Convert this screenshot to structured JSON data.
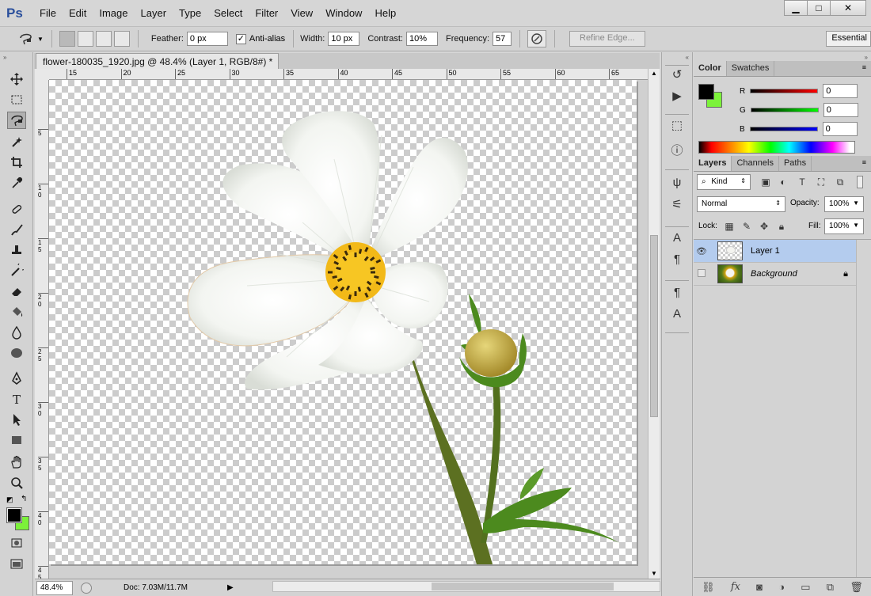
{
  "app": {
    "logo": "Ps",
    "brand_color": "#2a4f9c"
  },
  "menubar": {
    "items": [
      "File",
      "Edit",
      "Image",
      "Layer",
      "Type",
      "Select",
      "Filter",
      "View",
      "Window",
      "Help"
    ]
  },
  "window_controls": {
    "minimize": "▁",
    "maximize": "□",
    "close": "✕"
  },
  "options": {
    "feather_label": "Feather:",
    "feather_value": "0 px",
    "antialias_label": "Anti-alias",
    "antialias_checked": true,
    "width_label": "Width:",
    "width_value": "10 px",
    "contrast_label": "Contrast:",
    "contrast_value": "10%",
    "frequency_label": "Frequency:",
    "frequency_value": "57",
    "refine_label": "Refine Edge...",
    "workspace": "Essential"
  },
  "document": {
    "tab_title": "flower-180035_1920.jpg @ 48.4% (Layer 1, RGB/8#) *",
    "close": "×"
  },
  "ruler": {
    "top_ticks": [
      "15",
      "20",
      "25",
      "30",
      "35",
      "40",
      "45",
      "50",
      "55",
      "60",
      "65"
    ],
    "left_ticks": [
      "5",
      "1",
      "1",
      "2",
      "2",
      "3",
      "3",
      "4",
      "4"
    ],
    "left_ticks2": [
      "",
      "0",
      "5",
      "0",
      "5",
      "0",
      "5",
      "0",
      "5"
    ]
  },
  "status": {
    "zoom": "48.4%",
    "doc": "Doc: 7.03M/11.7M"
  },
  "color_panel": {
    "tabs": [
      "Color",
      "Swatches"
    ],
    "r_label": "R",
    "g_label": "G",
    "b_label": "B",
    "r": "0",
    "g": "0",
    "b": "0",
    "foreground": "#000000",
    "background": "#7cf23a"
  },
  "layers_panel": {
    "tabs": [
      "Layers",
      "Channels",
      "Paths"
    ],
    "kind": "Kind",
    "blend_mode": "Normal",
    "opacity_label": "Opacity:",
    "opacity": "100%",
    "lock_label": "Lock:",
    "fill_label": "Fill:",
    "fill": "100%",
    "layers": [
      {
        "name": "Layer 1",
        "selected": true,
        "visible": true
      },
      {
        "name": "Background",
        "selected": false,
        "visible": false,
        "locked": true
      }
    ]
  }
}
